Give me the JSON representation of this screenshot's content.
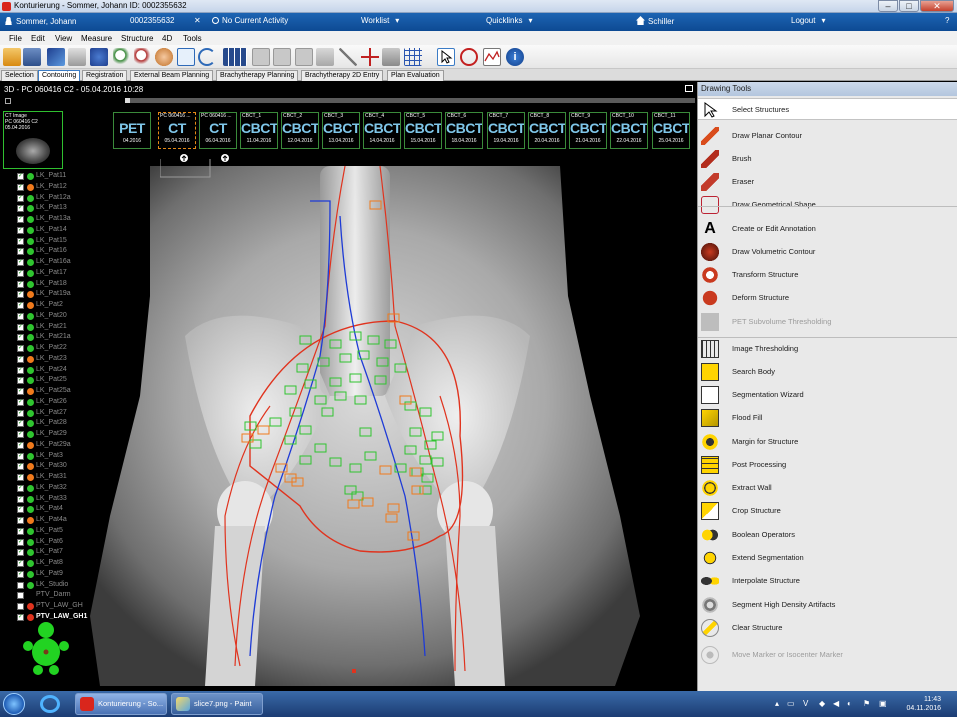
{
  "window": {
    "title": "Konturierung - Sommer, Johann  ID: 0002355632",
    "controls": {
      "minimize": "–",
      "maximize": "□",
      "close": "✕"
    }
  },
  "header": {
    "patient": "Sommer, Johann",
    "id": "0002355632",
    "activity": "No Current Activity",
    "worklist": "Worklist",
    "quicklinks": "Quicklinks",
    "home": "Schiller",
    "logout": "Logout",
    "help": "?"
  },
  "menu": [
    "File",
    "Edit",
    "View",
    "Measure",
    "Structure",
    "4D",
    "Tools"
  ],
  "tabs": [
    "Selection",
    "Contouring",
    "Registration",
    "External Beam Planning",
    "Brachytherapy Planning",
    "Brachytherapy 2D Entry",
    "Plan Evaluation"
  ],
  "active_tab": "Contouring",
  "viewer": {
    "title": "3D - PC 060416 C2 - 05.04.2016 10:28",
    "thumbnail": {
      "line1": "CT Image",
      "line2": "PC 060416 C2",
      "line3": "05.04.2016"
    }
  },
  "scans": [
    {
      "label": "",
      "modality": "PET",
      "date": "04.2016"
    },
    {
      "label": "PC 060416 ...",
      "modality": "CT",
      "date": "05.04.2016"
    },
    {
      "label": "PC 060416 ...",
      "modality": "CT",
      "date": "06.04.2016"
    },
    {
      "label": "CBCT_1",
      "modality": "CBCT",
      "date": "11.04.2016"
    },
    {
      "label": "CBCT_2",
      "modality": "CBCT",
      "date": "12.04.2016"
    },
    {
      "label": "CBCT_3",
      "modality": "CBCT",
      "date": "13.04.2016"
    },
    {
      "label": "CBCT_4",
      "modality": "CBCT",
      "date": "14.04.2016"
    },
    {
      "label": "CBCT_5",
      "modality": "CBCT",
      "date": "15.04.2016"
    },
    {
      "label": "CBCT_6",
      "modality": "CBCT",
      "date": "18.04.2016"
    },
    {
      "label": "CBCT_7",
      "modality": "CBCT",
      "date": "19.04.2016"
    },
    {
      "label": "CBCT_8",
      "modality": "CBCT",
      "date": "20.04.2016"
    },
    {
      "label": "CBCT_9",
      "modality": "CBCT",
      "date": "21.04.2016"
    },
    {
      "label": "CBCT_10",
      "modality": "CBCT",
      "date": "22.04.2016"
    },
    {
      "label": "CBCT_11",
      "modality": "CBCT",
      "date": "25.04.2016"
    }
  ],
  "structures": [
    {
      "name": "LK_Pat11",
      "color": "#2fc42f",
      "checked": true
    },
    {
      "name": "LK_Pat12",
      "color": "#f07a1c",
      "checked": true
    },
    {
      "name": "LK_Pat12a",
      "color": "#2fc42f",
      "checked": true
    },
    {
      "name": "LK_Pat13",
      "color": "#2fc42f",
      "checked": true
    },
    {
      "name": "LK_Pat13a",
      "color": "#2fc42f",
      "checked": true
    },
    {
      "name": "LK_Pat14",
      "color": "#2fc42f",
      "checked": true
    },
    {
      "name": "LK_Pat15",
      "color": "#2fc42f",
      "checked": true
    },
    {
      "name": "LK_Pat16",
      "color": "#2fc42f",
      "checked": true
    },
    {
      "name": "LK_Pat16a",
      "color": "#2fc42f",
      "checked": true
    },
    {
      "name": "LK_Pat17",
      "color": "#2fc42f",
      "checked": true
    },
    {
      "name": "LK_Pat18",
      "color": "#2fc42f",
      "checked": true
    },
    {
      "name": "LK_Pat19a",
      "color": "#f07a1c",
      "checked": true
    },
    {
      "name": "LK_Pat2",
      "color": "#f07a1c",
      "checked": true
    },
    {
      "name": "LK_Pat20",
      "color": "#2fc42f",
      "checked": true
    },
    {
      "name": "LK_Pat21",
      "color": "#2fc42f",
      "checked": true
    },
    {
      "name": "LK_Pat21a",
      "color": "#2fc42f",
      "checked": true
    },
    {
      "name": "LK_Pat22",
      "color": "#2fc42f",
      "checked": true
    },
    {
      "name": "LK_Pat23",
      "color": "#f07a1c",
      "checked": true
    },
    {
      "name": "LK_Pat24",
      "color": "#2fc42f",
      "checked": true
    },
    {
      "name": "LK_Pat25",
      "color": "#2fc42f",
      "checked": true
    },
    {
      "name": "LK_Pat25a",
      "color": "#f07a1c",
      "checked": true
    },
    {
      "name": "LK_Pat26",
      "color": "#2fc42f",
      "checked": true
    },
    {
      "name": "LK_Pat27",
      "color": "#2fc42f",
      "checked": true
    },
    {
      "name": "LK_Pat28",
      "color": "#2fc42f",
      "checked": true
    },
    {
      "name": "LK_Pat29",
      "color": "#2fc42f",
      "checked": true
    },
    {
      "name": "LK_Pat29a",
      "color": "#f07a1c",
      "checked": true
    },
    {
      "name": "LK_Pat3",
      "color": "#2fc42f",
      "checked": true
    },
    {
      "name": "LK_Pat30",
      "color": "#f07a1c",
      "checked": true
    },
    {
      "name": "LK_Pat31",
      "color": "#f07a1c",
      "checked": true
    },
    {
      "name": "LK_Pat32",
      "color": "#2fc42f",
      "checked": true
    },
    {
      "name": "LK_Pat33",
      "color": "#2fc42f",
      "checked": true
    },
    {
      "name": "LK_Pat4",
      "color": "#2fc42f",
      "checked": true
    },
    {
      "name": "LK_Pat4a",
      "color": "#f07a1c",
      "checked": true
    },
    {
      "name": "LK_Pat5",
      "color": "#2fc42f",
      "checked": true
    },
    {
      "name": "LK_Pat6",
      "color": "#2fc42f",
      "checked": true
    },
    {
      "name": "LK_Pat7",
      "color": "#2fc42f",
      "checked": true
    },
    {
      "name": "LK_Pat8",
      "color": "#2fc42f",
      "checked": true
    },
    {
      "name": "LK_Pat9",
      "color": "#2fc42f",
      "checked": true
    },
    {
      "name": "LK_Studio",
      "color": "#2fc42f",
      "checked": false
    },
    {
      "name": "PTV_Darm",
      "color": "",
      "checked": false
    },
    {
      "name": "PTV_LAW_GH",
      "color": "#e0331e",
      "checked": false
    },
    {
      "name": "PTV_LAW_GH1",
      "color": "#e0331e",
      "checked": true,
      "bright": true
    }
  ],
  "tools": {
    "title": "Drawing Tools",
    "items": [
      {
        "label": "Select Structures",
        "icon": "arrow-cursor-icon",
        "selected": true,
        "disabled": false
      },
      {
        "label": "Draw Planar Contour",
        "icon": "pencil-icon",
        "selected": false,
        "disabled": false
      },
      {
        "label": "Brush",
        "icon": "brush-icon",
        "selected": false,
        "disabled": false
      },
      {
        "label": "Eraser",
        "icon": "eraser-icon",
        "selected": false,
        "disabled": false
      },
      {
        "label": "Draw Geometrical Shape",
        "icon": "shape-icon",
        "selected": false,
        "disabled": false
      },
      {
        "label": "Create or Edit Annotation",
        "icon": "annotation-icon",
        "selected": false,
        "disabled": false
      },
      {
        "label": "Draw Volumetric Contour",
        "icon": "volumetric-icon",
        "selected": false,
        "disabled": false
      },
      {
        "label": "Transform Structure",
        "icon": "transform-icon",
        "selected": false,
        "disabled": false
      },
      {
        "label": "Deform Structure",
        "icon": "deform-icon",
        "selected": false,
        "disabled": false
      },
      {
        "label": "PET Subvolume Thresholding",
        "icon": "pet-icon",
        "selected": false,
        "disabled": true
      },
      {
        "label": "Image Thresholding",
        "icon": "threshold-icon",
        "selected": false,
        "disabled": false
      },
      {
        "label": "Search Body",
        "icon": "search-body-icon",
        "selected": false,
        "disabled": false
      },
      {
        "label": "Segmentation Wizard",
        "icon": "wizard-icon",
        "selected": false,
        "disabled": false
      },
      {
        "label": "Flood Fill",
        "icon": "flood-fill-icon",
        "selected": false,
        "disabled": false
      },
      {
        "label": "Margin for Structure",
        "icon": "margin-icon",
        "selected": false,
        "disabled": false
      },
      {
        "label": "Post Processing",
        "icon": "post-processing-icon",
        "selected": false,
        "disabled": false
      },
      {
        "label": "Extract Wall",
        "icon": "extract-wall-icon",
        "selected": false,
        "disabled": false
      },
      {
        "label": "Crop Structure",
        "icon": "crop-icon",
        "selected": false,
        "disabled": false
      },
      {
        "label": "Boolean Operators",
        "icon": "boolean-icon",
        "selected": false,
        "disabled": false
      },
      {
        "label": "Extend Segmentation",
        "icon": "extend-icon",
        "selected": false,
        "disabled": false
      },
      {
        "label": "Interpolate Structure",
        "icon": "interpolate-icon",
        "selected": false,
        "disabled": false
      },
      {
        "label": "Segment High Density Artifacts",
        "icon": "artifact-icon",
        "selected": false,
        "disabled": false
      },
      {
        "label": "Clear Structure",
        "icon": "clear-icon",
        "selected": false,
        "disabled": false
      },
      {
        "label": "Move Marker or Isocenter Marker",
        "icon": "marker-icon",
        "selected": false,
        "disabled": true
      }
    ]
  },
  "taskbar": {
    "buttons": [
      "Konturierung - So...",
      "slice7.png - Paint"
    ],
    "time": "11:43",
    "date": "04.11.2016"
  },
  "colors": {
    "header_blue": "#0d4a93",
    "accent_green": "#2fc42f",
    "accent_orange": "#f07a1c",
    "contour_red": "#e0331e",
    "contour_blue": "#1e3bd6"
  }
}
